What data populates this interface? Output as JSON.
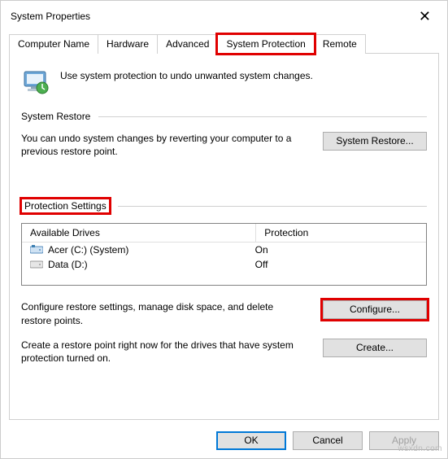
{
  "window": {
    "title": "System Properties"
  },
  "tabs": {
    "computer_name": "Computer Name",
    "hardware": "Hardware",
    "advanced": "Advanced",
    "system_protection": "System Protection",
    "remote": "Remote"
  },
  "intro": {
    "text": "Use system protection to undo unwanted system changes."
  },
  "sections": {
    "system_restore": "System Restore",
    "protection_settings": "Protection Settings"
  },
  "restore": {
    "desc": "You can undo system changes by reverting your computer to a previous restore point.",
    "button": "System Restore..."
  },
  "drives": {
    "col_drives": "Available Drives",
    "col_protection": "Protection",
    "rows": [
      {
        "name": "Acer (C:) (System)",
        "protection": "On"
      },
      {
        "name": "Data (D:)",
        "protection": "Off"
      }
    ]
  },
  "configure": {
    "desc": "Configure restore settings, manage disk space, and delete restore points.",
    "button": "Configure..."
  },
  "create": {
    "desc": "Create a restore point right now for the drives that have system protection turned on.",
    "button": "Create..."
  },
  "footer": {
    "ok": "OK",
    "cancel": "Cancel",
    "apply": "Apply"
  },
  "watermark": "wsxdn.com"
}
